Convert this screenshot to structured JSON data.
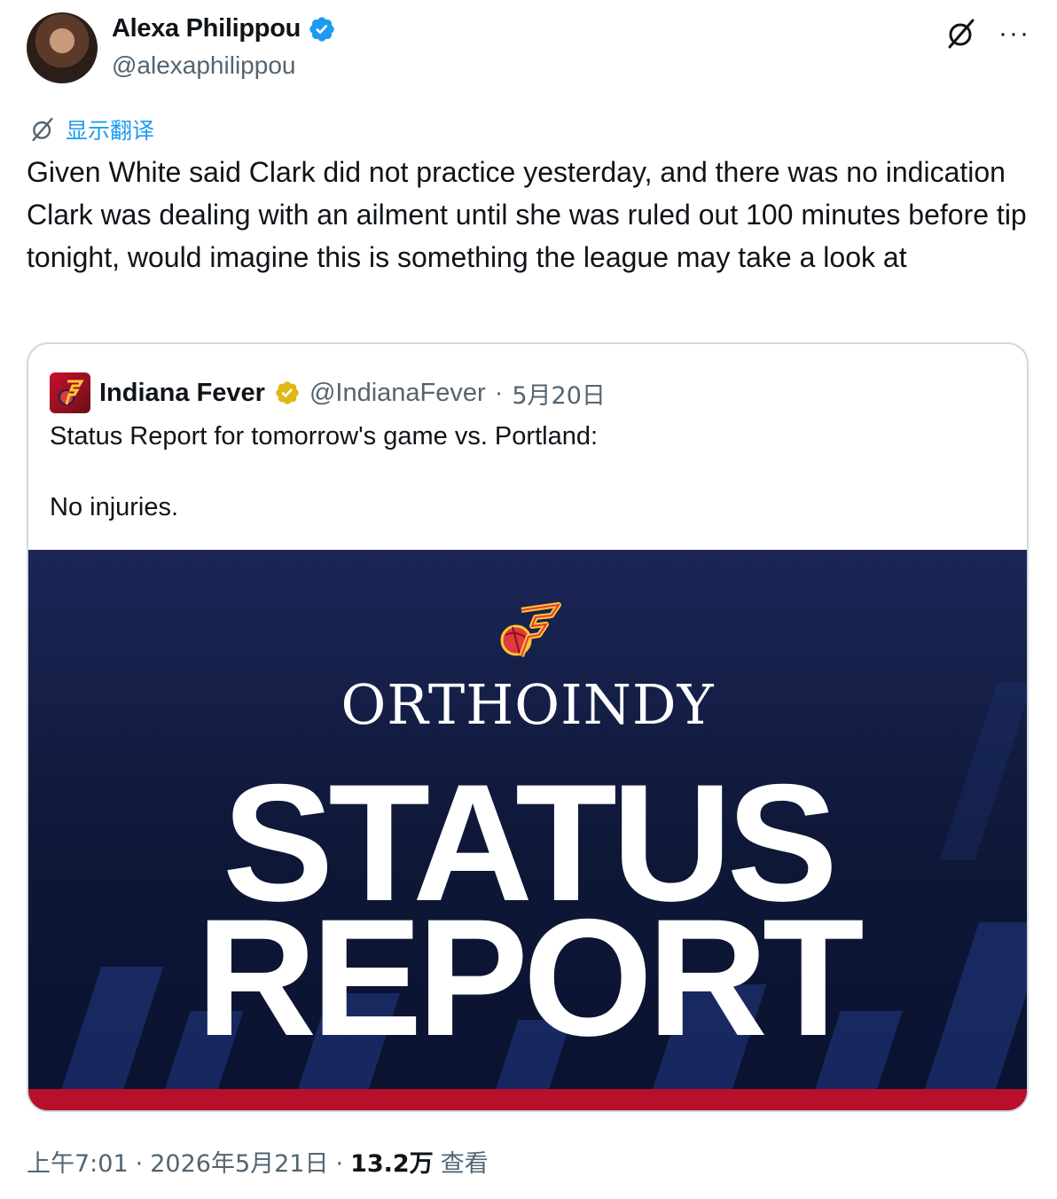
{
  "author": {
    "name": "Alexa Philippou",
    "handle": "@alexaphilippou"
  },
  "translate_label": "显示翻译",
  "tweet_text": "Given White said Clark did not practice yesterday, and there was no indication Clark was dealing with an ailment until she was ruled out 100 minutes before tip tonight, would imagine this is something the league may take a look at",
  "quote": {
    "name": "Indiana Fever",
    "handle": "@IndianaFever",
    "separator": "·",
    "date": "5月20日",
    "text": "Status Report for tomorrow's game vs. Portland:\n\nNo injuries.",
    "image": {
      "line1": "ORTHOINDY",
      "line2": "STATUS",
      "line3": "REPORT"
    }
  },
  "meta": {
    "time": "上午7:01",
    "sep1": "·",
    "date": "2026年5月21日",
    "sep2": "·",
    "views": "13.2万",
    "views_label": "查看"
  },
  "colors": {
    "accent": "#1d9bf0",
    "secondary_text": "#536471",
    "fever_red": "#b8102a",
    "fever_navy": "#0e1736"
  },
  "icons": [
    "verified-badge-icon",
    "grok-icon",
    "more-icon",
    "translate-icon",
    "gold-verified-badge-icon",
    "fever-logo-icon"
  ]
}
